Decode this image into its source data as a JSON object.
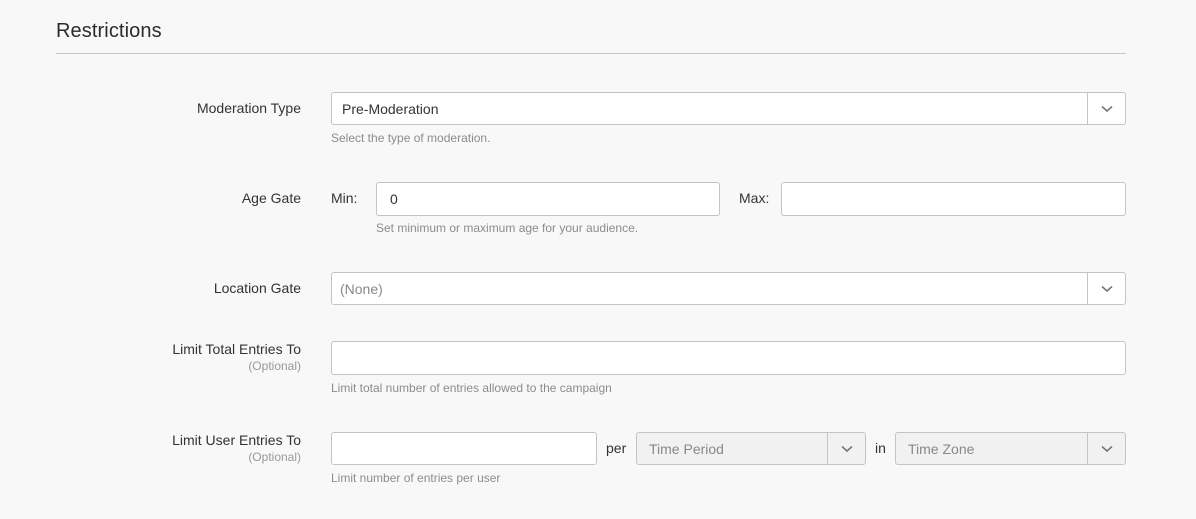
{
  "section": {
    "title": "Restrictions"
  },
  "moderation": {
    "label": "Moderation Type",
    "value": "Pre-Moderation",
    "help": "Select the type of moderation."
  },
  "age_gate": {
    "label": "Age Gate",
    "min_label": "Min:",
    "min_value": "0",
    "max_label": "Max:",
    "max_value": "",
    "help": "Set minimum or maximum age for your audience."
  },
  "location_gate": {
    "label": "Location Gate",
    "value": "(None)"
  },
  "limit_total": {
    "label": "Limit Total Entries To",
    "optional": "(Optional)",
    "value": "",
    "help": "Limit total number of entries allowed to the campaign"
  },
  "limit_user": {
    "label": "Limit User Entries To",
    "optional": "(Optional)",
    "value": "",
    "per_label": "per",
    "period_value": "Time Period",
    "in_label": "in",
    "timezone_value": "Time Zone",
    "help": "Limit number of entries per user"
  },
  "icons": {
    "dropdown": "chevron-down-icon"
  }
}
